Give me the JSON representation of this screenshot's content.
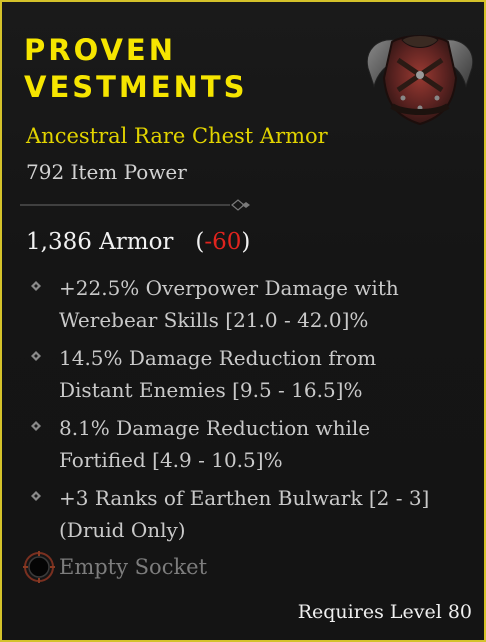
{
  "item": {
    "name_line1": "PROVEN",
    "name_line2": "VESTMENTS",
    "subtitle": "Ancestral Rare Chest Armor",
    "item_power": "792 Item Power",
    "armor": {
      "value": "1,386 Armor",
      "open": "(",
      "diff": "-60",
      "close": ")"
    },
    "affixes": [
      {
        "line1": "+22.5% Overpower Damage with",
        "line2": "Werebear Skills [21.0 - 42.0]%"
      },
      {
        "line1": "14.5% Damage Reduction from",
        "line2": "Distant Enemies [9.5 - 16.5]%"
      },
      {
        "line1": "8.1% Damage Reduction while",
        "line2": "Fortified [4.9 - 10.5]%"
      },
      {
        "line1": "+3 Ranks of Earthen Bulwark [2 - 3]",
        "line2": "(Druid Only)"
      }
    ],
    "socket_label": "Empty Socket",
    "requirement": "Requires Level 80"
  },
  "colors": {
    "border": "#d4c22a",
    "name": "#f6e500",
    "subtitle": "#e2d400",
    "armor_diff": "#e0241e",
    "affix_text": "#c9c9c9",
    "socket_text": "#7d7d7d"
  },
  "icons": {
    "item_image": "chest-armor-icon",
    "affix_bullet": "diamond-bullet-icon",
    "socket": "socket-icon"
  }
}
